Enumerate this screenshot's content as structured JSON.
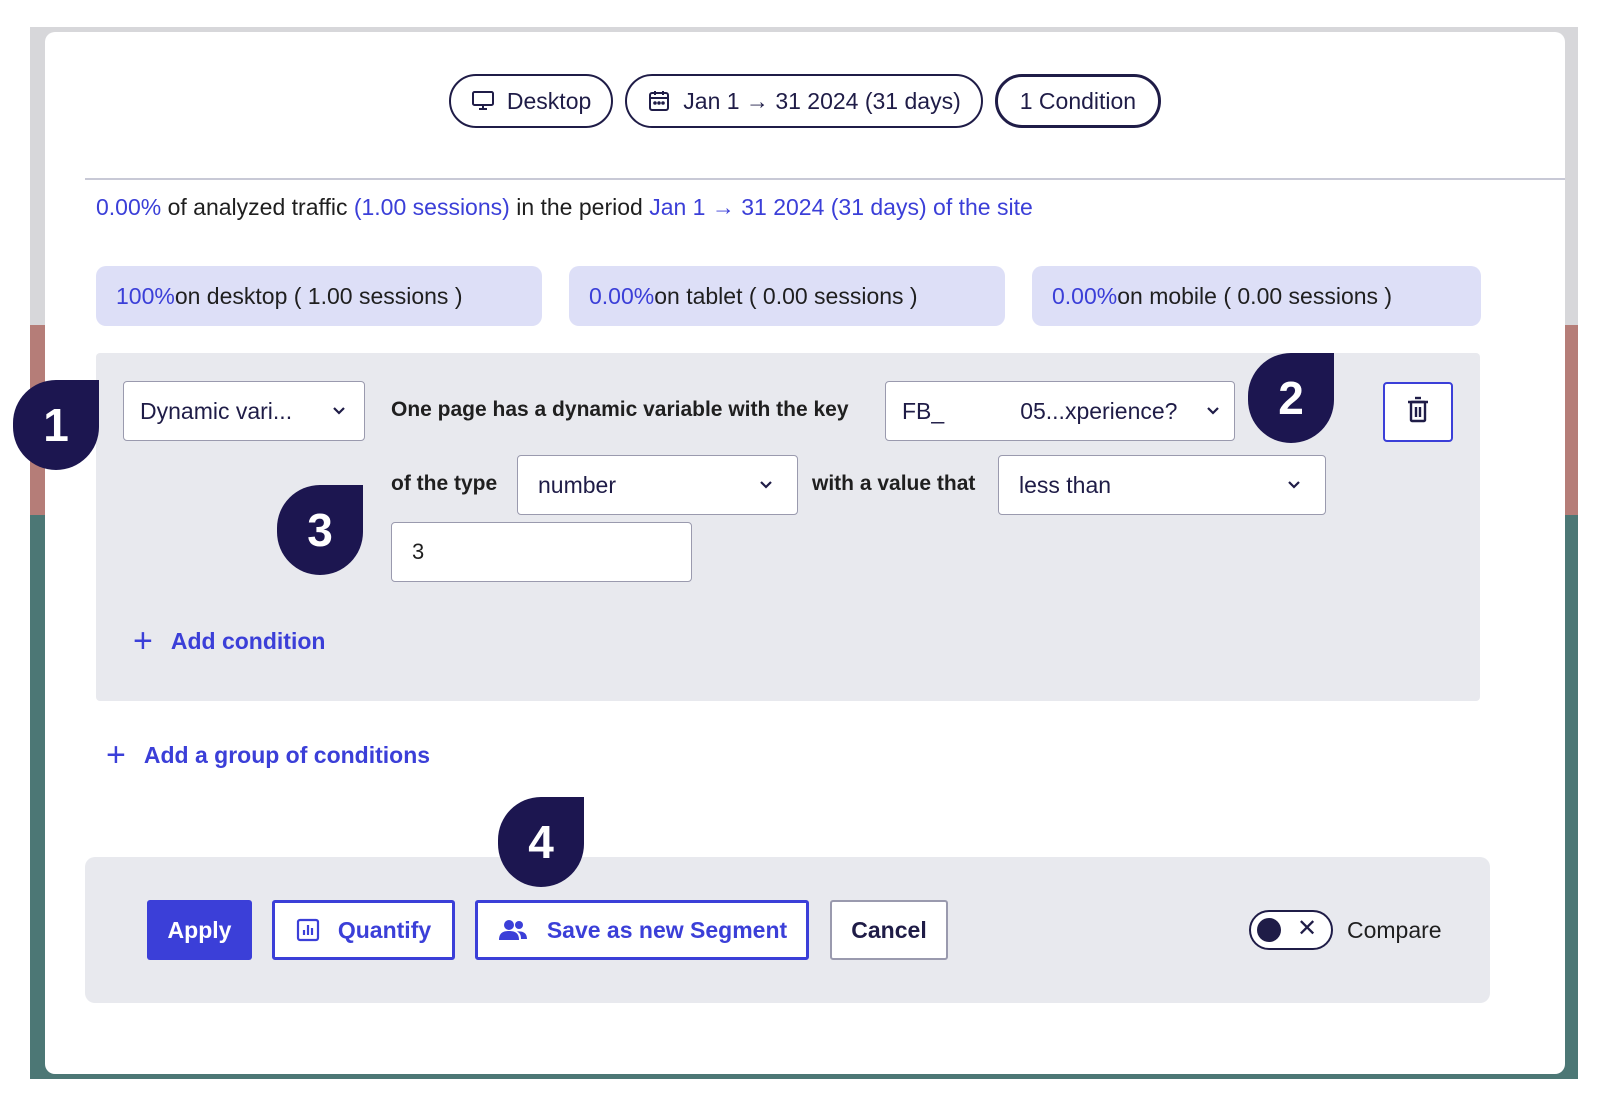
{
  "header": {
    "device_pill": "Desktop",
    "date_pill": "Jan 1 → 31 2024 (31 days)",
    "condition_pill": "1 Condition"
  },
  "summary": {
    "percent": "0.00%",
    "text1": " of analyzed traffic ",
    "sessions": "(1.00 sessions)",
    "text2": " in the period ",
    "period": "Jan 1 → 31 2024 (31 days) of the site"
  },
  "stats": [
    {
      "percent": "100%",
      "text": " on desktop ( 1.00 sessions )"
    },
    {
      "percent": "0.00%",
      "text": " on tablet ( 0.00 sessions )"
    },
    {
      "percent": "0.00%",
      "text": " on mobile ( 0.00 sessions )"
    }
  ],
  "condition": {
    "criterion_select": "Dynamic vari...",
    "key_label": "One page has a dynamic variable with the key",
    "key_select_prefix": "FB_",
    "key_select_suffix": "05...xperience?",
    "type_label": "of the type",
    "type_select": "number",
    "value_label": "with a value that",
    "operator_select": "less than",
    "value_input": "3"
  },
  "links": {
    "add_condition": "Add condition",
    "add_group": "Add a group of conditions"
  },
  "footer": {
    "apply": "Apply",
    "quantify": "Quantify",
    "save_segment": "Save as new Segment",
    "cancel": "Cancel",
    "compare": "Compare"
  },
  "markers": [
    "1",
    "2",
    "3",
    "4"
  ],
  "icons": {
    "device": "monitor-icon",
    "date": "calendar-icon",
    "delete": "trash-icon",
    "quantify": "bar-chart-icon",
    "segment": "users-icon",
    "dropdown": "chevron-down-icon",
    "add": "plus-icon",
    "toggle": "close-icon"
  },
  "colors": {
    "accent": "#3b3fd8",
    "navy": "#1f1c47",
    "marker": "#1c1650",
    "stat_bg": "#dddff7",
    "panel_bg": "#e8e9ee"
  }
}
